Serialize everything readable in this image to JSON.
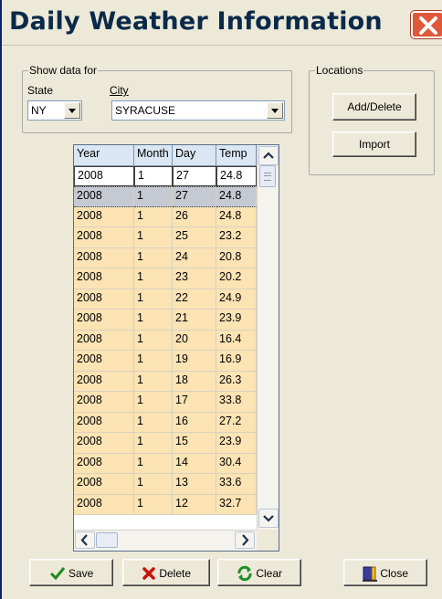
{
  "window": {
    "title": "Daily Weather Information"
  },
  "show_data": {
    "legend": "Show data for",
    "state_label": "State",
    "state_value": "NY",
    "city_label": "City",
    "city_value": "SYRACUSE"
  },
  "locations": {
    "legend": "Locations",
    "add_delete_label": "Add/Delete",
    "import_label": "Import"
  },
  "grid": {
    "headers": [
      "Year",
      "Month",
      "Day",
      "Temp"
    ],
    "edit_row": [
      "2008",
      "1",
      "27",
      "24.8"
    ],
    "selected_index": 0,
    "rows": [
      [
        "2008",
        "1",
        "27",
        "24.8"
      ],
      [
        "2008",
        "1",
        "26",
        "24.8"
      ],
      [
        "2008",
        "1",
        "25",
        "23.2"
      ],
      [
        "2008",
        "1",
        "24",
        "20.8"
      ],
      [
        "2008",
        "1",
        "23",
        "20.2"
      ],
      [
        "2008",
        "1",
        "22",
        "24.9"
      ],
      [
        "2008",
        "1",
        "21",
        "23.9"
      ],
      [
        "2008",
        "1",
        "20",
        "16.4"
      ],
      [
        "2008",
        "1",
        "19",
        "16.9"
      ],
      [
        "2008",
        "1",
        "18",
        "26.3"
      ],
      [
        "2008",
        "1",
        "17",
        "33.8"
      ],
      [
        "2008",
        "1",
        "16",
        "27.2"
      ],
      [
        "2008",
        "1",
        "15",
        "23.9"
      ],
      [
        "2008",
        "1",
        "14",
        "30.4"
      ],
      [
        "2008",
        "1",
        "13",
        "33.6"
      ],
      [
        "2008",
        "1",
        "12",
        "32.7"
      ]
    ]
  },
  "buttons": {
    "save": "Save",
    "delete": "Delete",
    "clear": "Clear",
    "close": "Close"
  },
  "colors": {
    "row_background": "#fbe3b4",
    "selected_row": "#c5c9d2",
    "title_text": "#0b2a4a",
    "close_button": "#e0583a"
  }
}
